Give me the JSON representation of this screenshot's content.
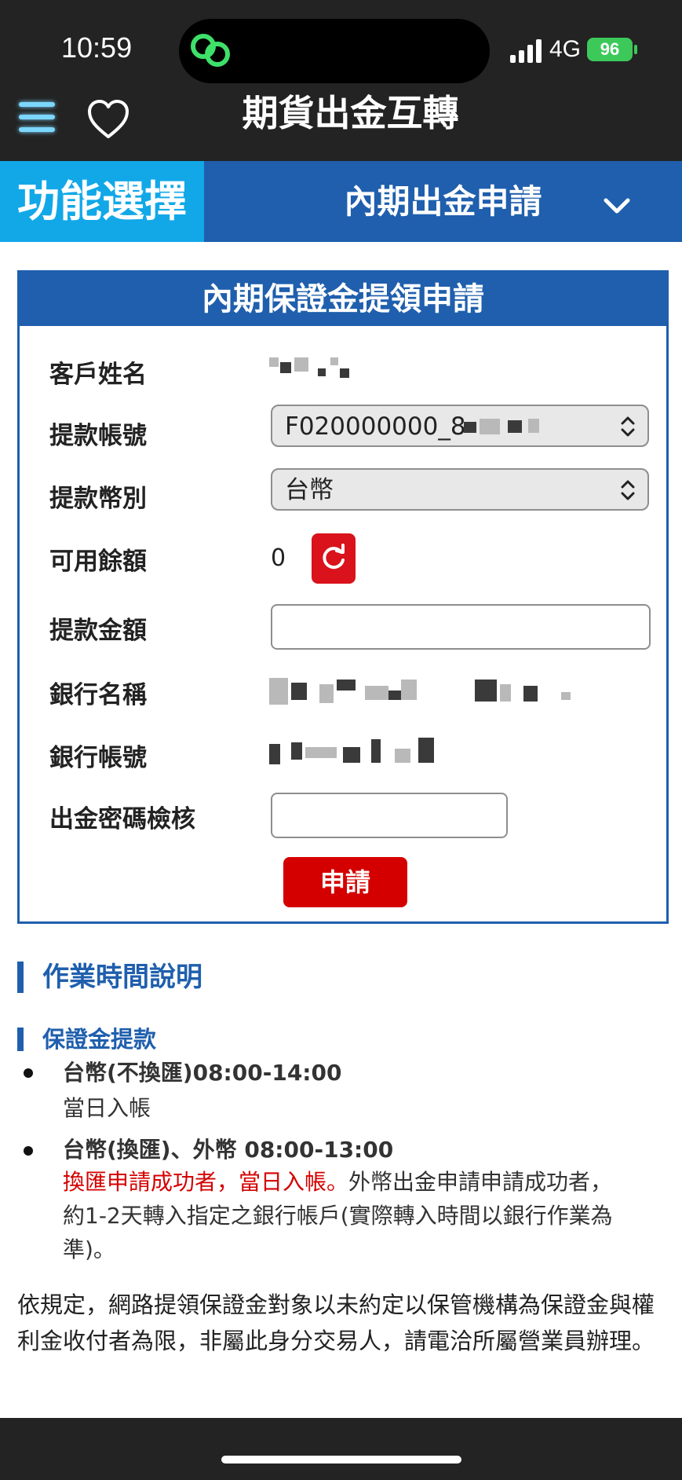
{
  "status_bar": {
    "time": "10:59",
    "network": "4G",
    "battery": "96"
  },
  "nav": {
    "title": "期貨出金互轉"
  },
  "function_bar": {
    "label": "功能選擇",
    "selected": "內期出金申請"
  },
  "form": {
    "heading": "內期保證金提領申請",
    "labels": {
      "customer_name": "客戶姓名",
      "account": "提款帳號",
      "currency": "提款幣別",
      "available": "可用餘額",
      "amount": "提款金額",
      "bank_name": "銀行名稱",
      "bank_account": "銀行帳號",
      "password": "出金密碼檢核"
    },
    "account_value": "F020000000_8",
    "currency_value": "台幣",
    "available_value": "0",
    "amount_value": "",
    "password_value": "",
    "submit_label": "申請"
  },
  "info": {
    "section_title": "作業時間說明",
    "subsection_title": "保證金提款",
    "item1": {
      "title": "台幣(不換匯)08:00-14:00",
      "note": "當日入帳"
    },
    "item2": {
      "title": "台幣(換匯)、外幣 08:00-13:00",
      "red_note": "換匯申請成功者，當日入帳。",
      "note_line1": "外幣出金申請申請成功者，",
      "note_line2": "約1-2天轉入指定之銀行帳戶(實際轉入時間以銀行作業為",
      "note_line3": "準)。"
    },
    "rule_line1": "依規定，網路提領保證金對象以未約定以保管機構為保證金與權",
    "rule_line2": "利金收付者為限，非屬此身分交易人，請電洽所屬營業員辦理。"
  },
  "colors": {
    "primary": "#1f5fad",
    "accent": "#12a8e8",
    "danger": "#d40000",
    "dark": "#232323"
  }
}
